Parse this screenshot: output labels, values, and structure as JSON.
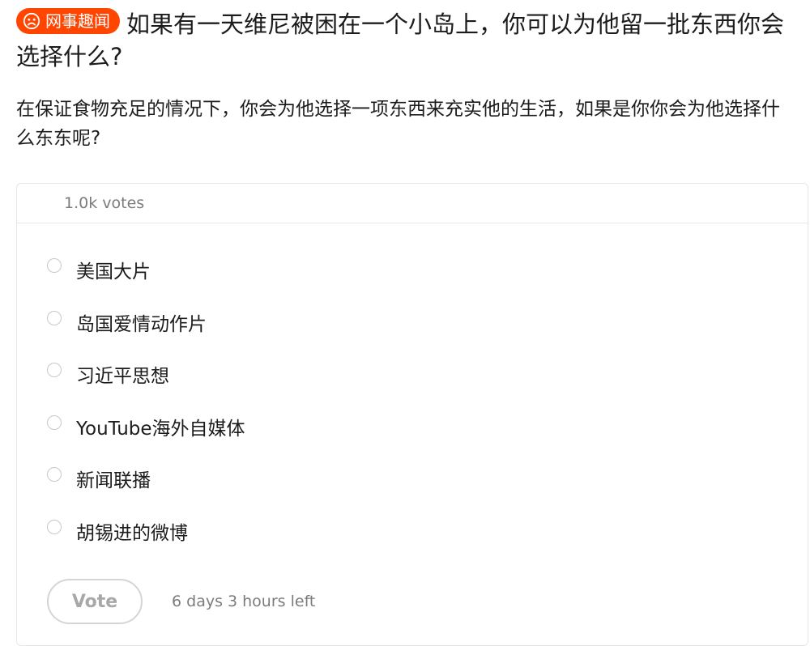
{
  "post": {
    "flair": {
      "label": "网事趣闻",
      "icon": "sad-face-icon",
      "color": "#ff4500"
    },
    "title": "如果有一天维尼被困在一个小岛上，你可以为他留一批东西你会选择什么?",
    "body": "在保证食物充足的情况下，你会为他选择一项东西来充实他的生活，如果是你你会为他选择什么东东呢?"
  },
  "poll": {
    "votes": "1.0k votes",
    "options": [
      {
        "label": "美国大片"
      },
      {
        "label": "岛国爱情动作片"
      },
      {
        "label": "习近平思想"
      },
      {
        "label": "YouTube海外自媒体"
      },
      {
        "label": "新闻联播"
      },
      {
        "label": "胡锡进的微博"
      }
    ],
    "vote_button": "Vote",
    "time_left": "6 days 3 hours left"
  }
}
